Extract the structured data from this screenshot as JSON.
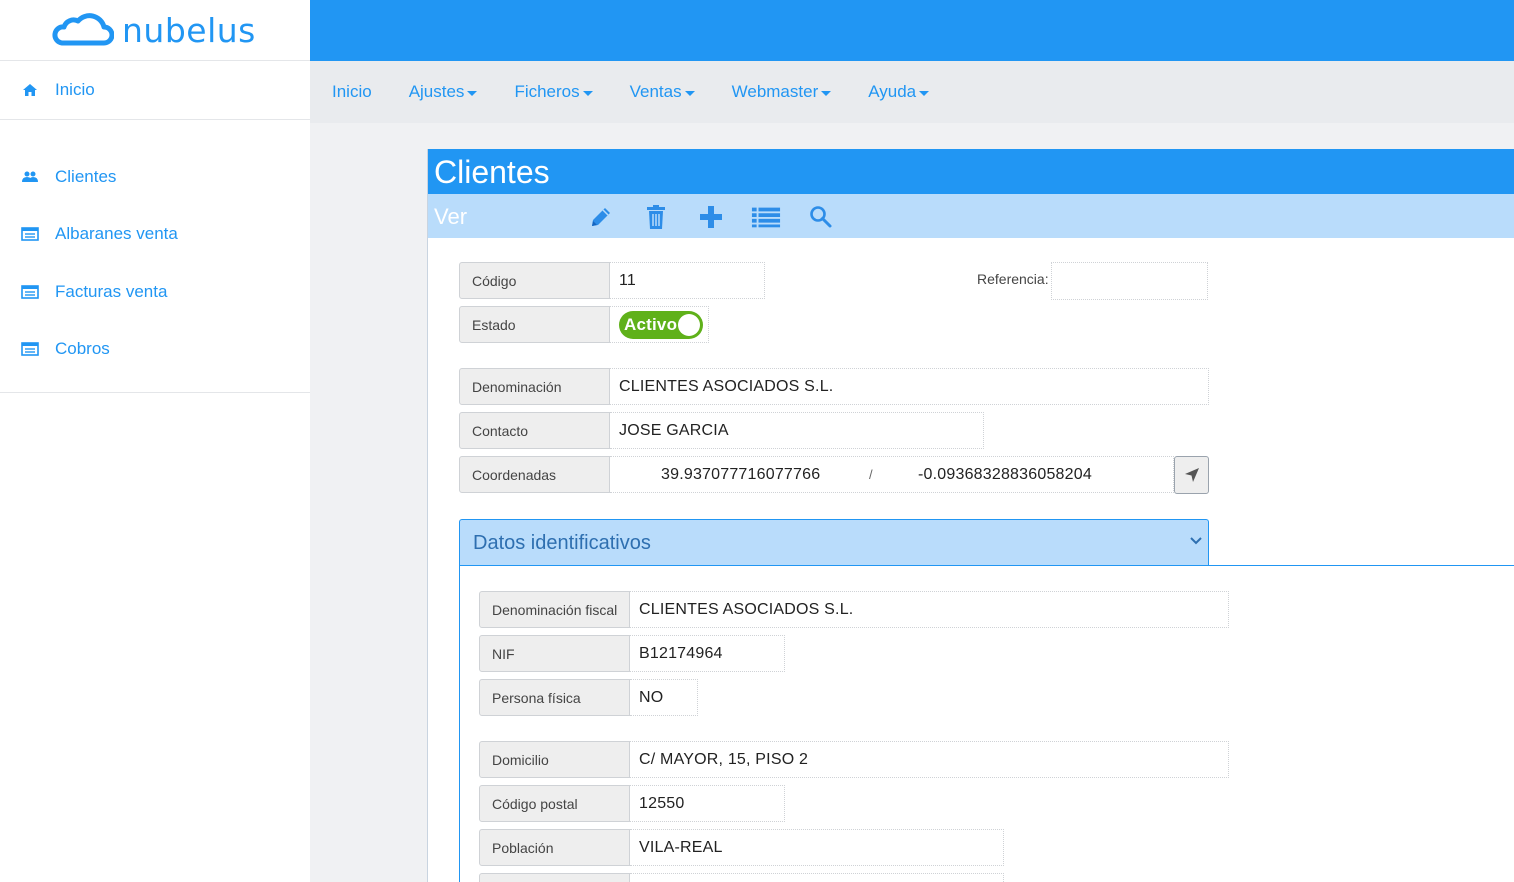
{
  "brand": {
    "name": "nubelus"
  },
  "sidebar": {
    "home": {
      "label": "Inicio",
      "icon": "home-icon"
    },
    "items": [
      {
        "label": "Clientes",
        "icon": "users-icon"
      },
      {
        "label": "Albaranes venta",
        "icon": "list-card-icon"
      },
      {
        "label": "Facturas venta",
        "icon": "list-card-icon"
      },
      {
        "label": "Cobros",
        "icon": "list-card-icon"
      }
    ]
  },
  "nav": {
    "items": [
      {
        "label": "Inicio",
        "dropdown": false
      },
      {
        "label": "Ajustes",
        "dropdown": true
      },
      {
        "label": "Ficheros",
        "dropdown": true
      },
      {
        "label": "Ventas",
        "dropdown": true
      },
      {
        "label": "Webmaster",
        "dropdown": true
      },
      {
        "label": "Ayuda",
        "dropdown": true
      }
    ]
  },
  "panel": {
    "title": "Clientes",
    "mode": "Ver",
    "toolbar": [
      "edit-pencil-icon",
      "trash-icon",
      "plus-icon",
      "list-icon",
      "search-icon"
    ]
  },
  "form": {
    "codigo": {
      "label": "Código",
      "value": "11"
    },
    "referencia": {
      "label": "Referencia:",
      "value": ""
    },
    "estado": {
      "label": "Estado",
      "toggle_label": "Activo",
      "on": true
    },
    "denominacion": {
      "label": "Denominación",
      "value": "CLIENTES ASOCIADOS S.L."
    },
    "contacto": {
      "label": "Contacto",
      "value": "JOSE GARCIA"
    },
    "coordenadas": {
      "label": "Coordenadas",
      "lat": "39.937077716077766",
      "separator": "/",
      "lng": "-0.09368328836058204"
    }
  },
  "section": {
    "title": "Datos identificativos",
    "fields": {
      "denominacion_fiscal": {
        "label": "Denominación fiscal",
        "value": "CLIENTES ASOCIADOS S.L."
      },
      "nif": {
        "label": "NIF",
        "value": "B12174964"
      },
      "persona_fisica": {
        "label": "Persona física",
        "value": "NO"
      },
      "domicilio": {
        "label": "Domicilio",
        "value": "C/ MAYOR, 15, PISO 2"
      },
      "codigo_postal": {
        "label": "Código postal",
        "value": "12550"
      },
      "poblacion": {
        "label": "Población",
        "value": "VILA-REAL"
      }
    }
  },
  "colors": {
    "primary": "#2196f3",
    "toolbar": "#b9dcfb",
    "toggle_on": "#5fb11a",
    "nav_bg": "#e9ebee"
  }
}
